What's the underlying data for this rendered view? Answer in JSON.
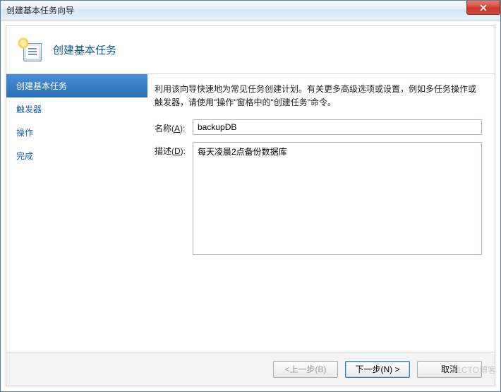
{
  "window": {
    "title": "创建基本任务向导"
  },
  "header": {
    "title": "创建基本任务"
  },
  "sidebar": {
    "items": [
      {
        "label": "创建基本任务",
        "active": true
      },
      {
        "label": "触发器"
      },
      {
        "label": "操作"
      },
      {
        "label": "完成"
      }
    ]
  },
  "main": {
    "hint": "利用该向导快速地为常见任务创建计划。有关更多高级选项或设置，例如多任务操作或触发器，请使用\"操作\"窗格中的\"创建任务\"命令。",
    "name_label_prefix": "名称(",
    "name_label_key": "A",
    "name_label_suffix": "):",
    "name_value": "backupDB",
    "desc_label_prefix": "描述(",
    "desc_label_key": "D",
    "desc_label_suffix": "):",
    "desc_value": "每天凌晨2点备份数据库"
  },
  "footer": {
    "back": "<上一步(B)",
    "next": "下一步(N) >",
    "cancel": "取消"
  },
  "watermark": "51CTO博客"
}
